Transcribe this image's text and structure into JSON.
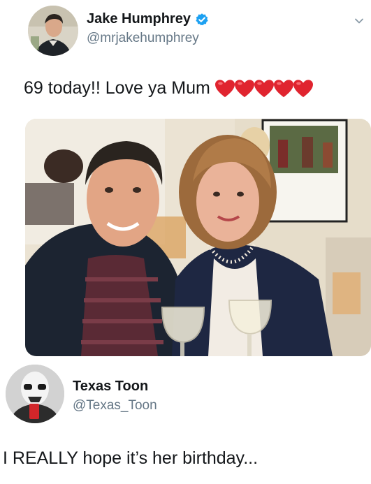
{
  "tweet": {
    "author_name": "Jake Humphrey",
    "author_handle": "@mrjakehumphrey",
    "text": "69 today!! Love ya Mum",
    "heart_count": 5,
    "avatar_icon": "profile-photo",
    "verified_icon": "verified-badge-icon",
    "caret_icon": "chevron-down-icon",
    "photo_icon": "attached-photo"
  },
  "reply": {
    "author_name": "Texas Toon",
    "author_handle": "@Texas_Toon",
    "text": "I REALLY hope it’s her birthday...",
    "avatar_icon": "stormtrooper-avatar"
  },
  "colors": {
    "text_primary": "#14171a",
    "text_secondary": "#657786",
    "verified_blue": "#1da1f2",
    "heart_red": "#e0242f"
  }
}
